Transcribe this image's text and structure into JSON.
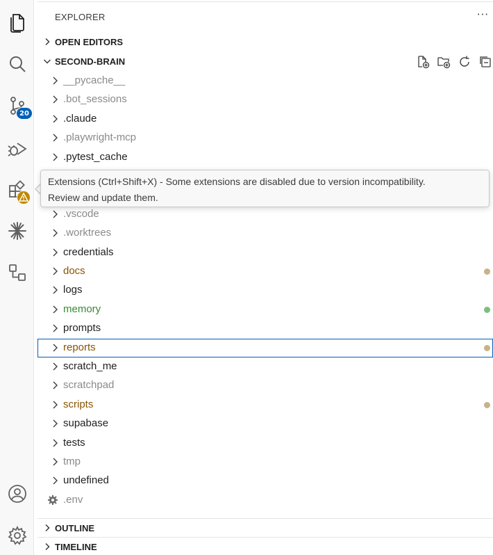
{
  "activity_bar": {
    "items": [
      {
        "name": "explorer-icon",
        "active": true
      },
      {
        "name": "search-icon"
      },
      {
        "name": "source-control-icon",
        "badge": "20"
      },
      {
        "name": "run-debug-icon"
      },
      {
        "name": "extensions-icon",
        "warning": true
      },
      {
        "name": "claude-icon"
      },
      {
        "name": "remote-explorer-icon"
      }
    ],
    "bottom": [
      {
        "name": "accounts-icon"
      },
      {
        "name": "manage-gear-icon"
      }
    ],
    "scm_badge": "20"
  },
  "sidebar": {
    "title": "EXPLORER",
    "more": "···",
    "sections": {
      "open_editors": "OPEN EDITORS",
      "workspace": "SECOND-BRAIN",
      "outline": "OUTLINE",
      "timeline": "TIMELINE"
    }
  },
  "tree": [
    {
      "name": "__pycache__",
      "color": "#8a8a8a",
      "kind": "folder"
    },
    {
      "name": ".bot_sessions",
      "color": "#8a8a8a",
      "kind": "folder"
    },
    {
      "name": ".claude",
      "color": "#1f1f1f",
      "kind": "folder"
    },
    {
      "name": ".playwright-mcp",
      "color": "#8a8a8a",
      "kind": "folder"
    },
    {
      "name": ".pytest_cache",
      "color": "#1f1f1f",
      "kind": "folder"
    },
    {
      "name": "",
      "kind": "hidden"
    },
    {
      "name": "",
      "kind": "hidden"
    },
    {
      "name": ".vscode",
      "color": "#8a8a8a",
      "kind": "folder"
    },
    {
      "name": ".worktrees",
      "color": "#8a8a8a",
      "kind": "folder"
    },
    {
      "name": "credentials",
      "color": "#1f1f1f",
      "kind": "folder"
    },
    {
      "name": "docs",
      "color": "#895503",
      "kind": "folder",
      "dot": "#c9b18a"
    },
    {
      "name": "logs",
      "color": "#1f1f1f",
      "kind": "folder"
    },
    {
      "name": "memory",
      "color": "#388a34",
      "kind": "folder",
      "dot": "#7dbf7d"
    },
    {
      "name": "prompts",
      "color": "#1f1f1f",
      "kind": "folder"
    },
    {
      "name": "reports",
      "color": "#895503",
      "kind": "folder",
      "dot": "#c9b18a",
      "selected": true
    },
    {
      "name": "scratch_me",
      "color": "#1f1f1f",
      "kind": "folder"
    },
    {
      "name": "scratchpad",
      "color": "#8a8a8a",
      "kind": "folder"
    },
    {
      "name": "scripts",
      "color": "#895503",
      "kind": "folder",
      "dot": "#c9b18a"
    },
    {
      "name": "supabase",
      "color": "#1f1f1f",
      "kind": "folder"
    },
    {
      "name": "tests",
      "color": "#1f1f1f",
      "kind": "folder"
    },
    {
      "name": "tmp",
      "color": "#8a8a8a",
      "kind": "folder"
    },
    {
      "name": "undefined",
      "color": "#1f1f1f",
      "kind": "folder"
    },
    {
      "name": ".env",
      "color": "#8a8a8a",
      "kind": "file-gear"
    }
  ],
  "tooltip": {
    "line1": "Extensions (Ctrl+Shift+X) - Some extensions are disabled due to version incompatibility.",
    "line2": "Review and update them."
  },
  "colors": {
    "accent": "#005fb8",
    "modified": "#895503",
    "untracked": "#388a34",
    "ignored": "#8a8a8a",
    "warning": "#bf8803"
  }
}
